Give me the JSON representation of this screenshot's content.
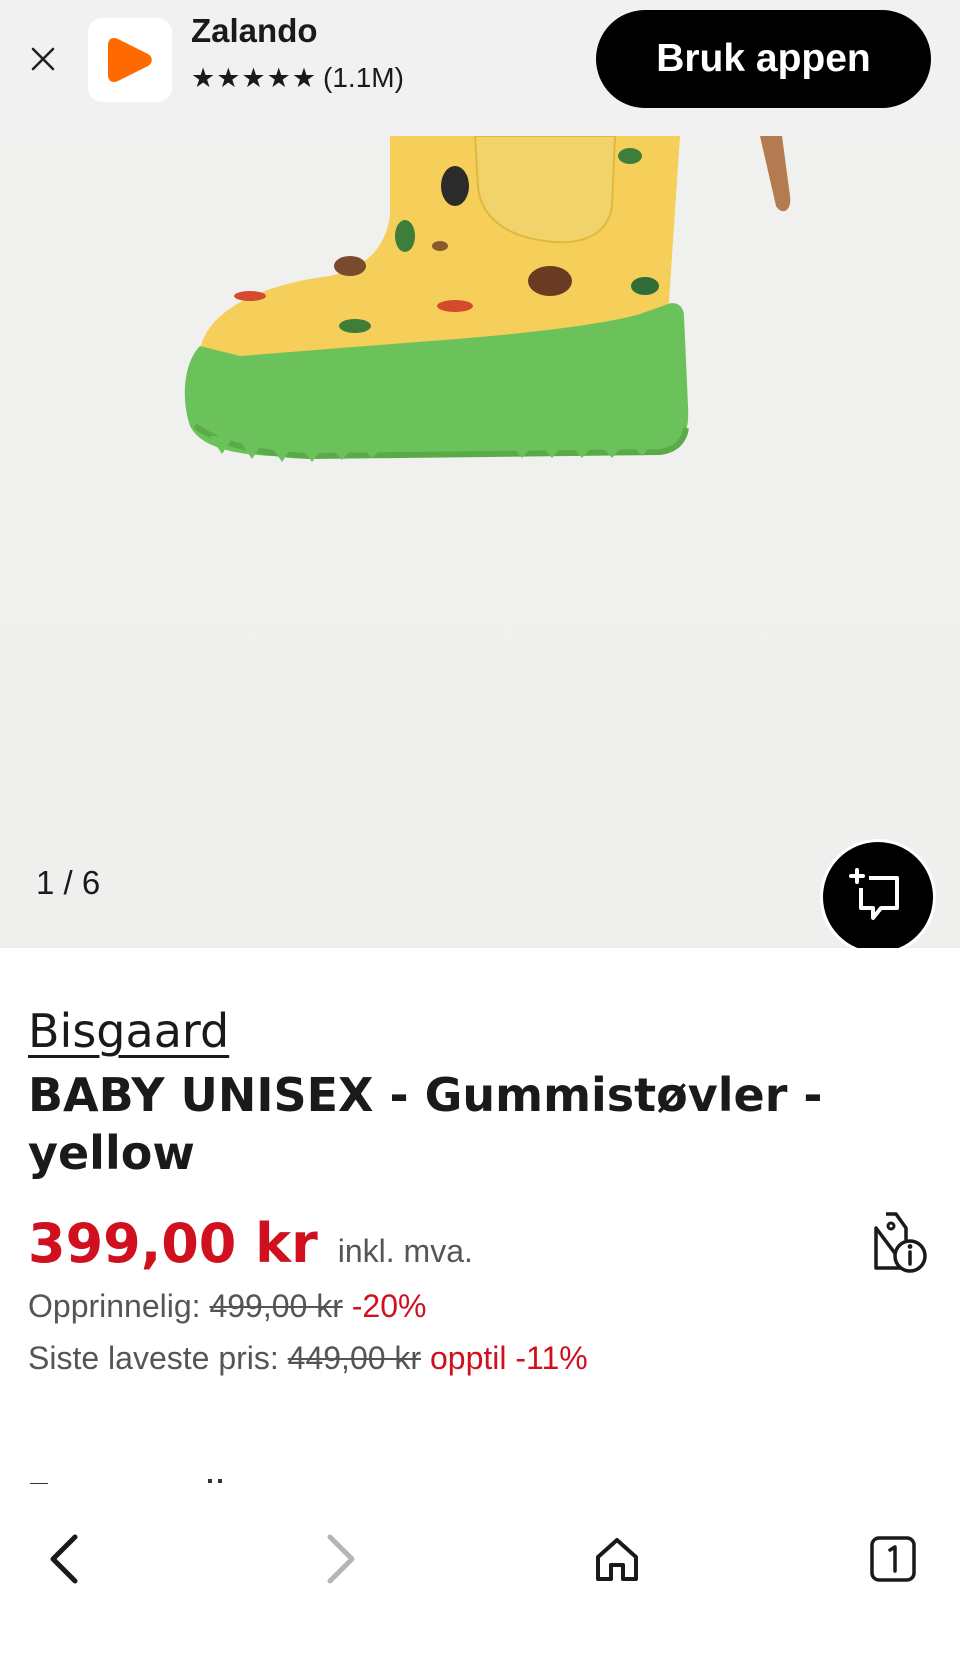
{
  "banner": {
    "app_name": "Zalando",
    "stars": "★★★★★",
    "rating_count": "(1.1M)",
    "cta_label": "Bruk appen",
    "logo_color": "#ff6900"
  },
  "gallery": {
    "counter": "1 / 6"
  },
  "product": {
    "brand": "Bisgaard",
    "title": "BABY UNISEX - Gummistøvler - yellow",
    "price": "399,00 kr",
    "vat": "inkl. mva.",
    "original_label": "Opprinnelig:",
    "original_price": "499,00 kr",
    "original_discount": "-20%",
    "lowest_label": "Siste laveste pris:",
    "lowest_price": "449,00 kr",
    "lowest_discount": "opptil -11%"
  },
  "colors": {
    "sale_red": "#d0101e",
    "boot_yellow": "#f5cf5a",
    "sole_green": "#6cc25a"
  }
}
